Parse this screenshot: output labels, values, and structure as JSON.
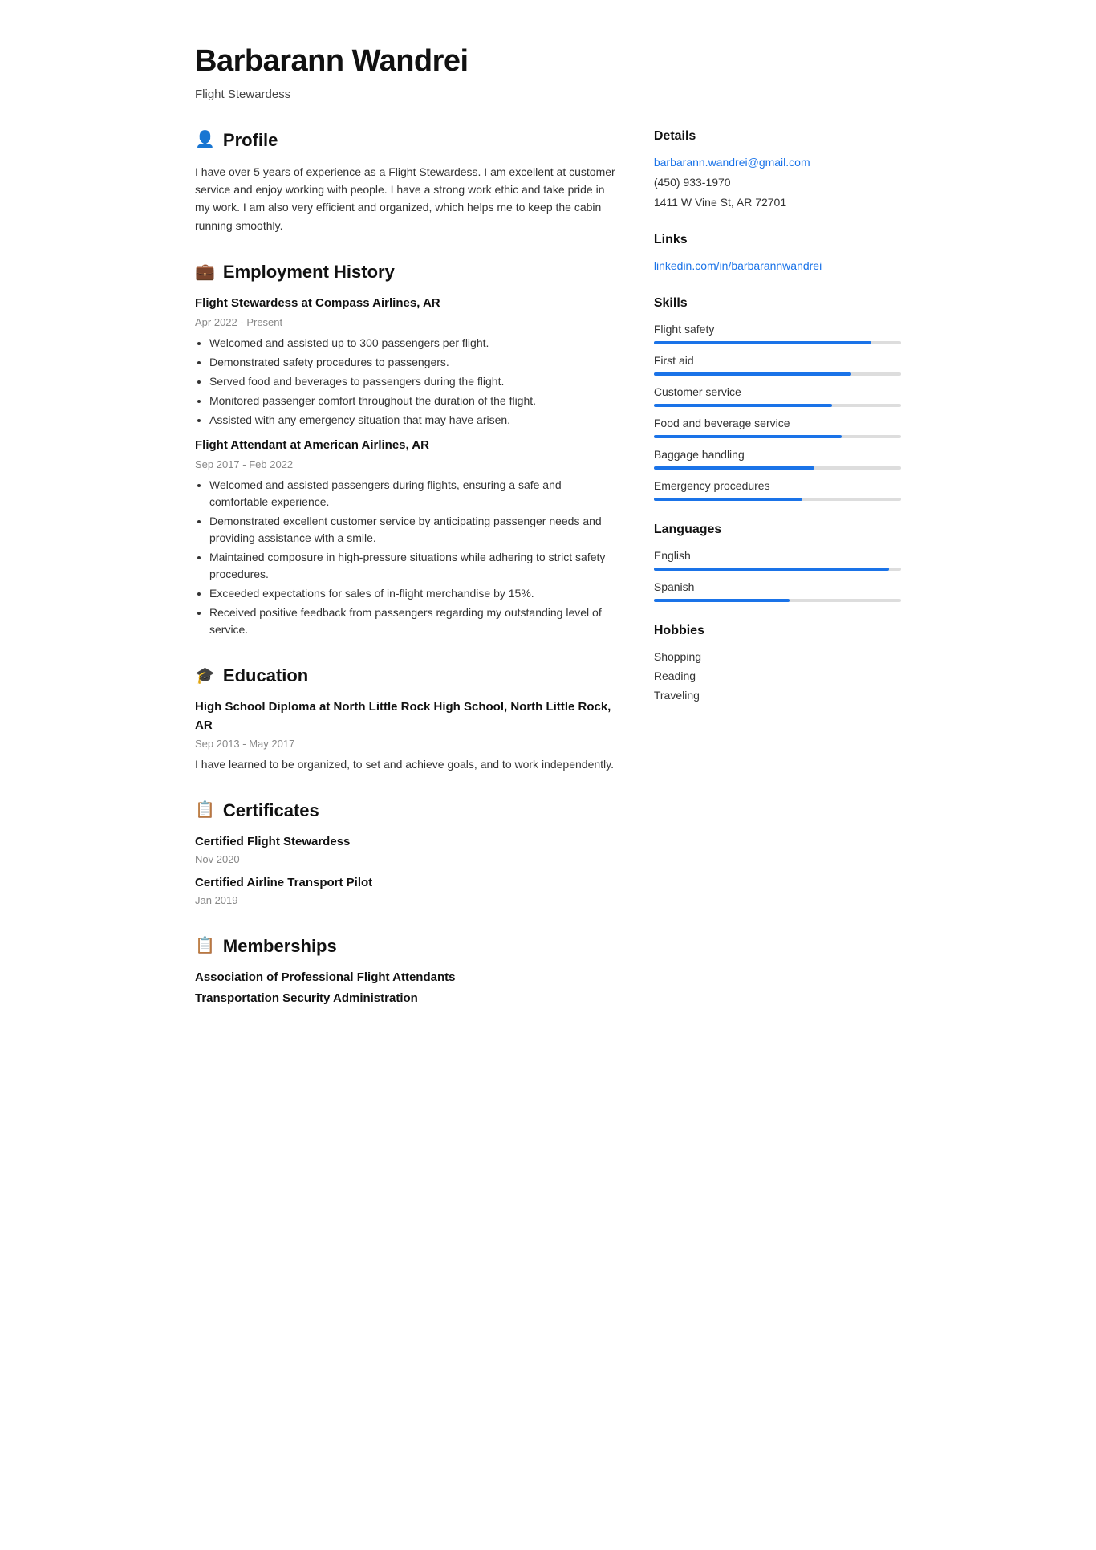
{
  "header": {
    "name": "Barbarann Wandrei",
    "subtitle": "Flight Stewardess"
  },
  "profile": {
    "section_title": "Profile",
    "icon": "👤",
    "text": "I have over 5 years of experience as a Flight Stewardess. I am excellent at customer service and enjoy working with people. I have a strong work ethic and take pride in my work. I am also very efficient and organized, which helps me to keep the cabin running smoothly."
  },
  "employment": {
    "section_title": "Employment History",
    "icon": "💼",
    "jobs": [
      {
        "title": "Flight Stewardess at Compass Airlines, AR",
        "date": "Apr 2022 - Present",
        "bullets": [
          "Welcomed and assisted up to 300 passengers per flight.",
          "Demonstrated safety procedures to passengers.",
          "Served food and beverages to passengers during the flight.",
          "Monitored passenger comfort throughout the duration of the flight.",
          "Assisted with any emergency situation that may have arisen."
        ]
      },
      {
        "title": "Flight Attendant at American Airlines, AR",
        "date": "Sep 2017 - Feb 2022",
        "bullets": [
          "Welcomed and assisted passengers during flights, ensuring a safe and comfortable experience.",
          "Demonstrated excellent customer service by anticipating passenger needs and providing assistance with a smile.",
          "Maintained composure in high-pressure situations while adhering to strict safety procedures.",
          "Exceeded expectations for sales of in-flight merchandise by 15%.",
          "Received positive feedback from passengers regarding my outstanding level of service."
        ]
      }
    ]
  },
  "education": {
    "section_title": "Education",
    "icon": "🎓",
    "entries": [
      {
        "title": "High School Diploma at North Little Rock High School, North Little Rock, AR",
        "date": "Sep 2013 - May 2017",
        "text": "I have learned to be organized, to set and achieve goals, and to work independently."
      }
    ]
  },
  "certificates": {
    "section_title": "Certificates",
    "icon": "📋",
    "entries": [
      {
        "name": "Certified Flight Stewardess",
        "date": "Nov 2020"
      },
      {
        "name": "Certified Airline Transport Pilot",
        "date": "Jan 2019"
      }
    ]
  },
  "memberships": {
    "section_title": "Memberships",
    "icon": "📋",
    "entries": [
      {
        "name": "Association of Professional Flight Attendants"
      },
      {
        "name": "Transportation Security Administration"
      }
    ]
  },
  "details": {
    "section_title": "Details",
    "email": "barbarann.wandrei@gmail.com",
    "phone": "(450) 933-1970",
    "address": "1411 W Vine St, AR 72701"
  },
  "links": {
    "section_title": "Links",
    "linkedin": "linkedin.com/in/barbarannwandrei"
  },
  "skills": {
    "section_title": "Skills",
    "items": [
      {
        "label": "Flight safety",
        "percent": 88
      },
      {
        "label": "First aid",
        "percent": 80
      },
      {
        "label": "Customer service",
        "percent": 72
      },
      {
        "label": "Food and beverage service",
        "percent": 76
      },
      {
        "label": "Baggage handling",
        "percent": 65
      },
      {
        "label": "Emergency procedures",
        "percent": 60
      }
    ]
  },
  "languages": {
    "section_title": "Languages",
    "items": [
      {
        "label": "English",
        "percent": 95
      },
      {
        "label": "Spanish",
        "percent": 55
      }
    ]
  },
  "hobbies": {
    "section_title": "Hobbies",
    "items": [
      "Shopping",
      "Reading",
      "Traveling"
    ]
  }
}
